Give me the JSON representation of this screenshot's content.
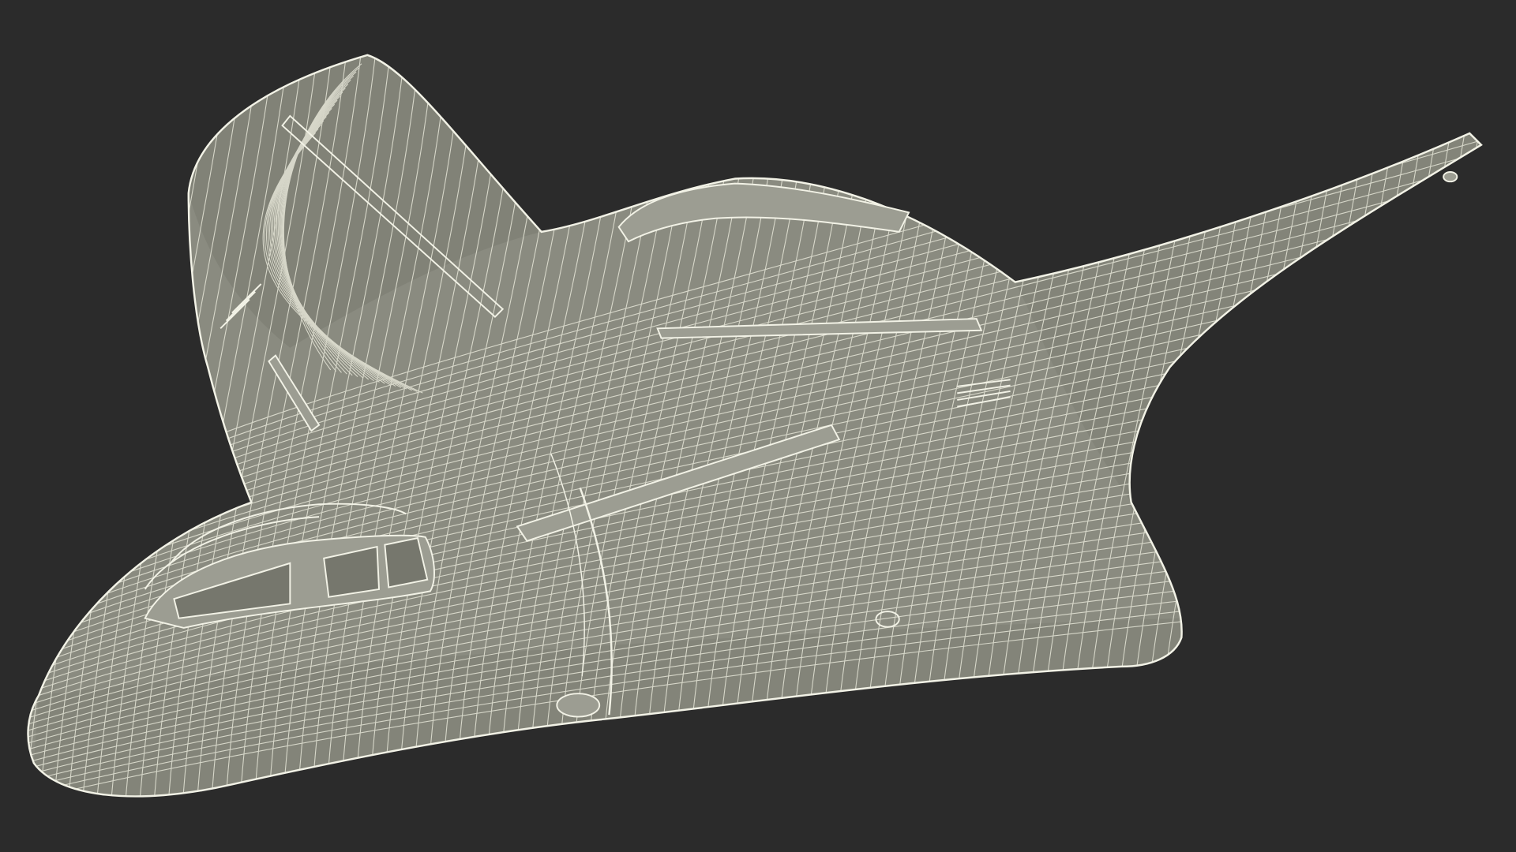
{
  "scene": {
    "subject_icon": "wireframe-aircraft-icon",
    "colors": {
      "background": "#2b2b2b",
      "surface": "#8a8b80",
      "surface_dark": "#76776d",
      "surface_light": "#9c9d92",
      "wire": "#f2f2e6",
      "wire_faint": "#e6e6d8"
    }
  }
}
